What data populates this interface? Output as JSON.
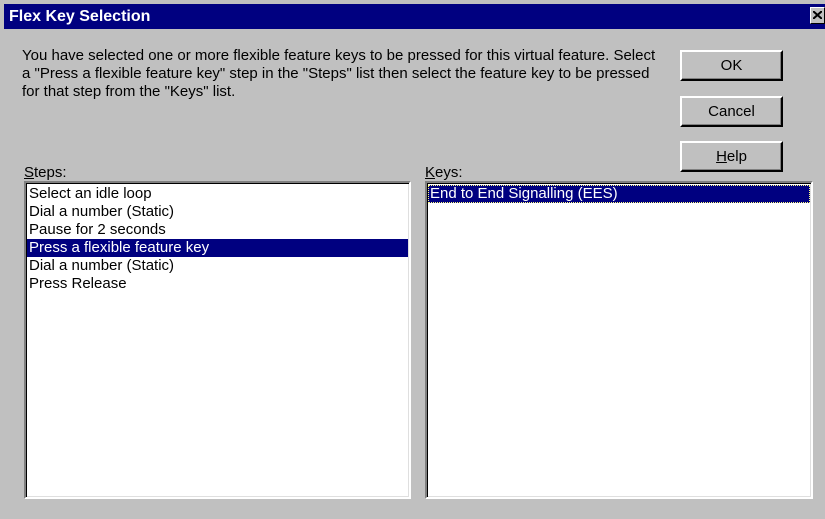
{
  "window": {
    "title": "Flex Key Selection"
  },
  "description": "You have selected one or more flexible feature keys to be pressed for this virtual feature. Select a \"Press a flexible feature key\" step in the \"Steps\" list then select the feature key to be pressed for that step from the \"Keys\" list.",
  "buttons": {
    "ok": "OK",
    "cancel": "Cancel",
    "help": {
      "mnemonic": "H",
      "rest": "elp"
    }
  },
  "steps": {
    "label": {
      "mnemonic": "S",
      "rest": "teps:"
    },
    "items": [
      "Select an idle loop",
      "Dial a number (Static)",
      "Pause for 2 seconds",
      "Press a flexible feature key",
      "Dial a number (Static)",
      "Press Release"
    ],
    "selected_index": 3
  },
  "keys": {
    "label": {
      "mnemonic": "K",
      "rest": "eys:"
    },
    "items": [
      "End to End Signalling (EES)"
    ],
    "selected_index": 0
  },
  "colors": {
    "title_bar": "#000080",
    "face": "#c0c0c0",
    "selection": "#000080"
  },
  "icons": {
    "close": "close-icon"
  }
}
